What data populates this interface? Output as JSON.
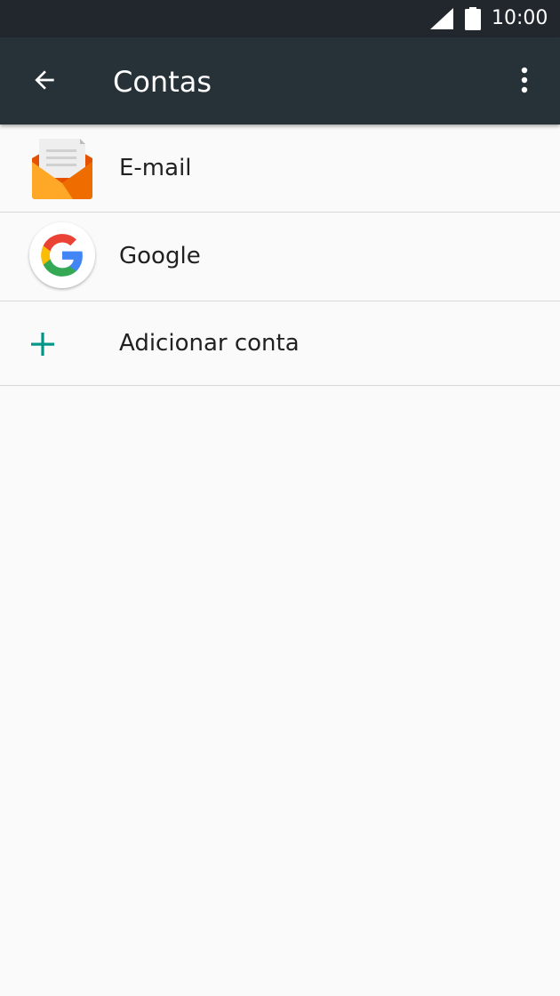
{
  "status_bar": {
    "time": "10:00",
    "icons": [
      "signal-icon",
      "battery-icon"
    ]
  },
  "app_bar": {
    "title": "Contas",
    "back_icon": "arrow-back-icon",
    "menu_icon": "more-vert-icon"
  },
  "accounts": {
    "items": [
      {
        "label": "E-mail",
        "icon": "email-app-icon"
      },
      {
        "label": "Google",
        "icon": "google-icon"
      }
    ],
    "add": {
      "label": "Adicionar conta",
      "icon": "plus-icon"
    }
  },
  "colors": {
    "status_bar_bg": "#21272d",
    "app_bar_bg": "#263238",
    "accent": "#009688",
    "background": "#fafafa",
    "divider": "#d9d9d9"
  }
}
